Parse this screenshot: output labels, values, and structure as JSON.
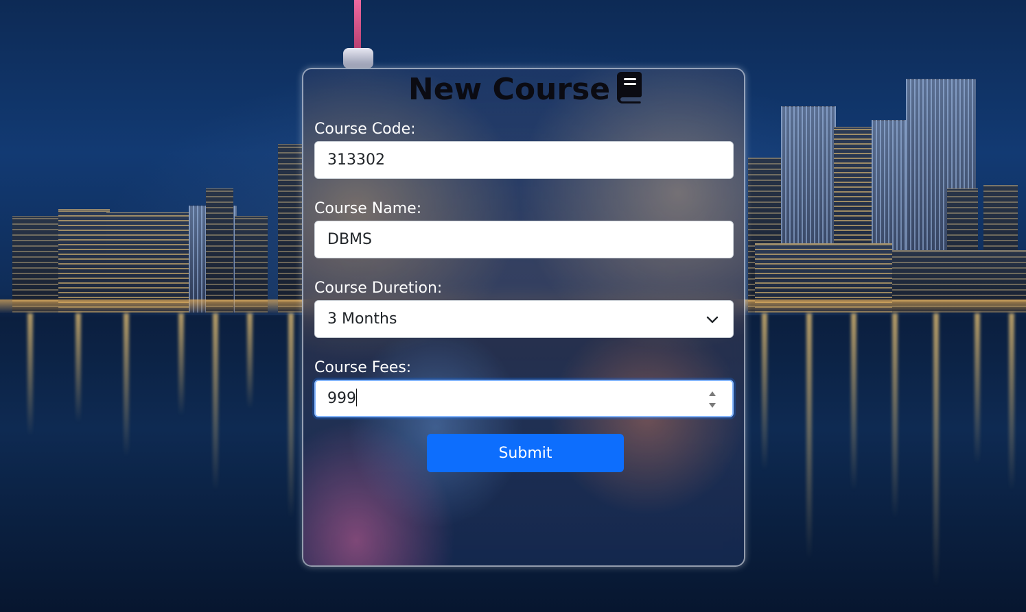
{
  "form": {
    "title": "New Course",
    "title_icon": "book-icon",
    "course_code": {
      "label": "Course Code:",
      "value": "313302"
    },
    "course_name": {
      "label": "Course Name:",
      "value": "DBMS"
    },
    "course_duration": {
      "label": "Course Duretion:",
      "selected": "3 Months"
    },
    "course_fees": {
      "label": "Course Fees:",
      "value": "999"
    },
    "submit_label": "Submit"
  },
  "colors": {
    "accent": "#0d6efd",
    "title_text": "#0b0b12",
    "label_text": "#ffffff"
  }
}
